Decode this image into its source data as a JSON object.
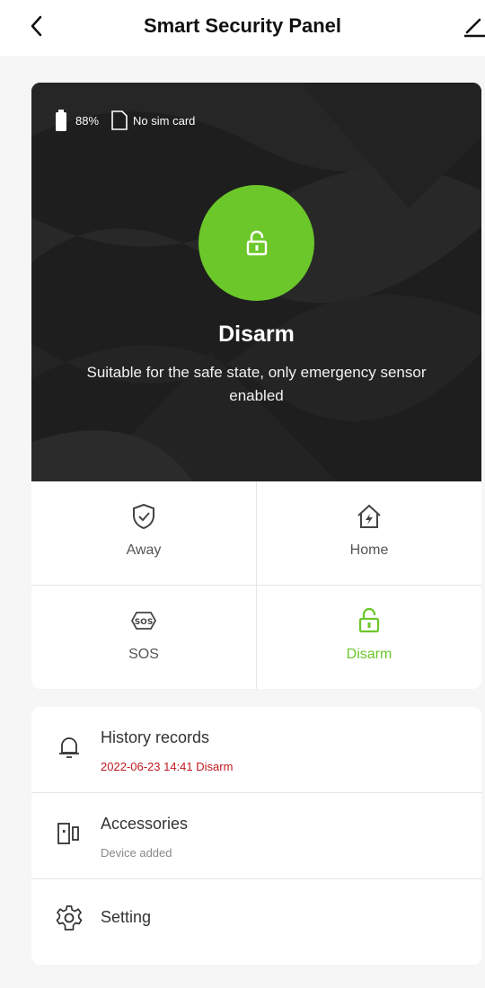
{
  "header": {
    "title": "Smart Security Panel",
    "back_icon": "chevron-left-icon",
    "edit_icon": "pencil-icon"
  },
  "panel": {
    "battery_percent": "88%",
    "sim_status": "No sim card",
    "state_title": "Disarm",
    "state_description": "Suitable for the safe state, only emergency sensor enabled",
    "accent_color": "#6cc72a"
  },
  "modes": [
    {
      "label": "Away",
      "icon": "shield-check-icon",
      "active": false
    },
    {
      "label": "Home",
      "icon": "home-bolt-icon",
      "active": false
    },
    {
      "label": "SOS",
      "icon": "sos-icon",
      "active": false
    },
    {
      "label": "Disarm",
      "icon": "unlock-icon",
      "active": true
    }
  ],
  "menu": {
    "history": {
      "title": "History records",
      "subtitle": "2022-06-23 14:41 Disarm",
      "icon": "bell-icon"
    },
    "accessories": {
      "title": "Accessories",
      "subtitle": "Device added",
      "icon": "door-sensor-icon"
    },
    "setting": {
      "title": "Setting",
      "icon": "gear-icon"
    }
  }
}
